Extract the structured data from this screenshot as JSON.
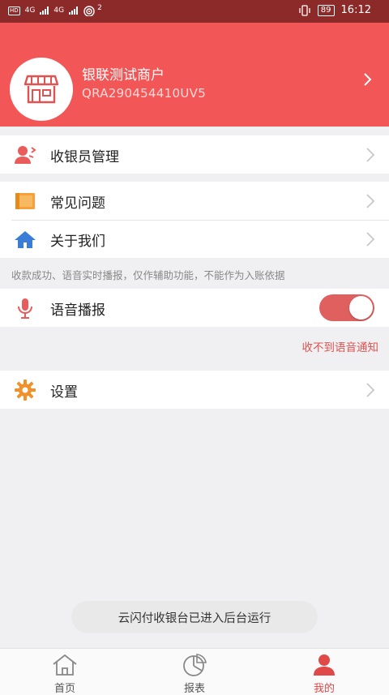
{
  "statusbar": {
    "left_badge": "HD",
    "net1": "4G",
    "net2": "4G",
    "hotspot_count": "2",
    "battery": "89",
    "time": "16:12"
  },
  "merchant": {
    "name": "银联测试商户",
    "id": "QRA290454410UV5"
  },
  "menu": {
    "cashier": "收银员管理",
    "faq": "常见问题",
    "about": "关于我们",
    "notice": "收款成功、语音实时播报，仅作辅助功能，不能作为入账依据",
    "voice": "语音播报",
    "voice_enabled": true,
    "no_voice_link": "收不到语音通知",
    "settings": "设置"
  },
  "toast": "云闪付收银台已进入后台运行",
  "tabs": [
    {
      "label": "首页",
      "icon": "home-icon",
      "active": false
    },
    {
      "label": "报表",
      "icon": "pie-chart-icon",
      "active": false
    },
    {
      "label": "我的",
      "icon": "user-icon",
      "active": true
    }
  ],
  "colors": {
    "brand": "#f25656",
    "statusbar": "#8c2a2a",
    "active_tab": "#e14848",
    "toggle_on": "#e06060"
  }
}
